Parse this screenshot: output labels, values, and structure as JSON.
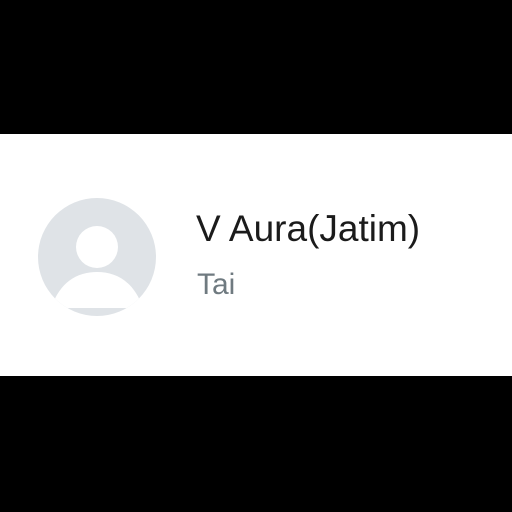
{
  "contact": {
    "name": "V Aura(Jatim)",
    "subtitle": "Tai",
    "avatar_icon": "default-person-avatar-icon"
  },
  "colors": {
    "card_background": "#ffffff",
    "page_background": "#000000",
    "avatar_background": "#dfe3e7",
    "avatar_figure": "#ffffff",
    "name_text": "#1b1b1b",
    "subtitle_text": "#6f7a80"
  }
}
